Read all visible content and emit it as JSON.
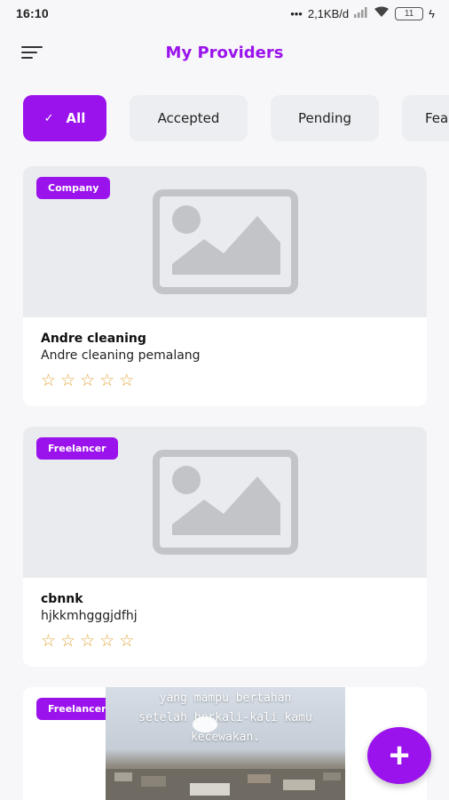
{
  "status_bar": {
    "time": "16:10",
    "network_speed": "2,1KB/d",
    "battery": "11"
  },
  "header": {
    "title": "My Providers"
  },
  "filters": [
    {
      "label": "All",
      "active": true
    },
    {
      "label": "Accepted",
      "active": false
    },
    {
      "label": "Pending",
      "active": false
    },
    {
      "label": "Fea",
      "active": false
    }
  ],
  "providers": [
    {
      "badge": "Company",
      "name": "Andre cleaning",
      "description": "Andre cleaning pemalang",
      "rating": 0,
      "max_rating": 5,
      "image": "image-placeholder-icon"
    },
    {
      "badge": "Freelancer",
      "name": "cbnnk",
      "description": "hjkkmhgggjdfhj",
      "rating": 0,
      "max_rating": 5,
      "image": "image-placeholder-icon"
    },
    {
      "badge": "Freelancer",
      "image": "photo",
      "caption_lines": [
        "yang mampu bertahan",
        "setelah berkali-kali kamu",
        "kecewakan."
      ]
    }
  ],
  "fab": {
    "icon": "plus-icon"
  },
  "colors": {
    "accent": "#9b13ec",
    "star": "#e1a941",
    "chip_bg": "#eceef1"
  }
}
